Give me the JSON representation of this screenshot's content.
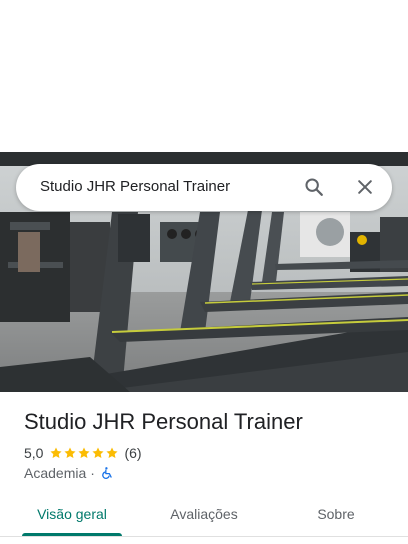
{
  "search": {
    "query": "Studio JHR Personal Trainer",
    "search_icon": "search-icon",
    "close_icon": "close-icon"
  },
  "hero": {
    "photo": "gym-treadmills-photo"
  },
  "place": {
    "name": "Studio JHR Personal Trainer",
    "rating": "5,0",
    "stars": 5,
    "review_count": "(6)",
    "category": "Academia",
    "separator": "·",
    "accessibility_icon": "wheelchair-icon"
  },
  "tabs": [
    {
      "label": "Visão geral",
      "active": true
    },
    {
      "label": "Avaliações",
      "active": false
    },
    {
      "label": "Sobre",
      "active": false
    }
  ],
  "colors": {
    "accent": "#00796b",
    "star": "#fbbc04",
    "accessibility": "#1a73e8"
  }
}
